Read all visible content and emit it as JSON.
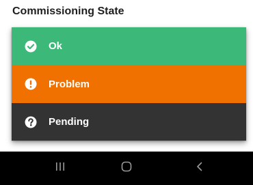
{
  "dialog": {
    "title": "Commissioning State",
    "options": [
      {
        "label": "Ok",
        "icon": "check-circle-icon",
        "color": "#3cb878"
      },
      {
        "label": "Problem",
        "icon": "exclamation-circle-icon",
        "color": "#f07000"
      },
      {
        "label": "Pending",
        "icon": "question-circle-icon",
        "color": "#333333"
      }
    ]
  },
  "navigation_bar": {
    "background": "#000000",
    "buttons": [
      {
        "icon": "recent-apps-icon"
      },
      {
        "icon": "home-icon"
      },
      {
        "icon": "back-icon"
      }
    ]
  }
}
